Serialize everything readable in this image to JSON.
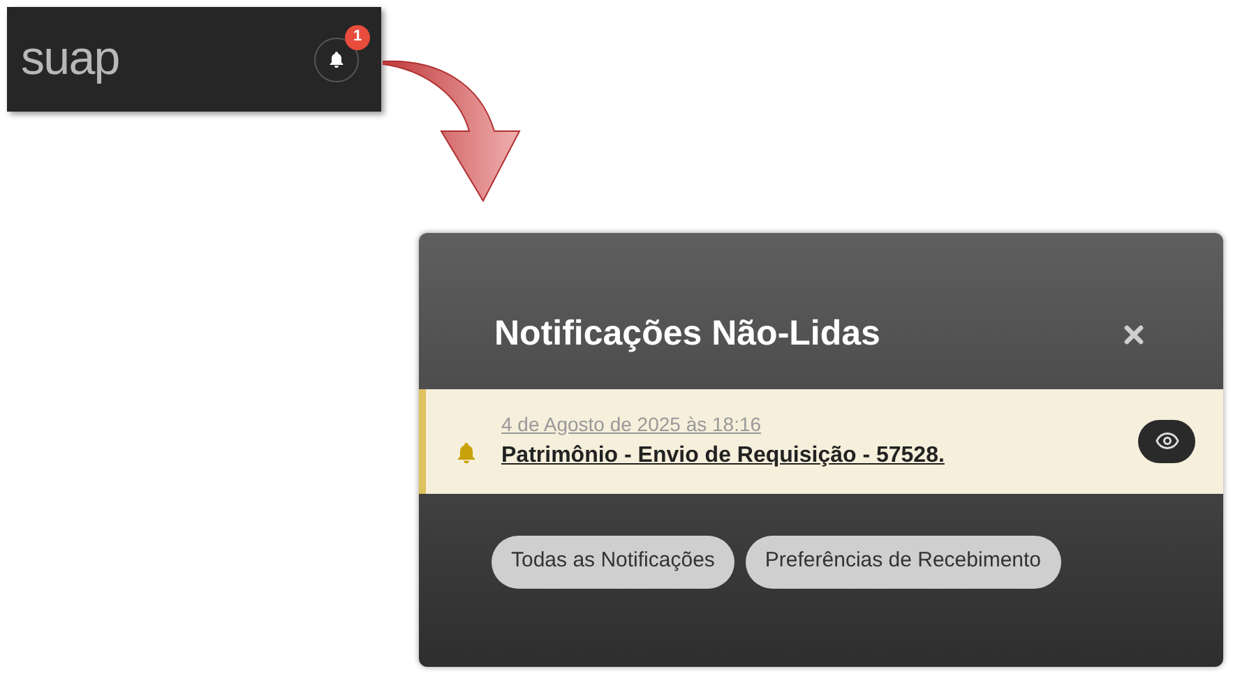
{
  "header": {
    "logo": "suap",
    "notification_count": "1"
  },
  "panel": {
    "title": "Notificações Não-Lidas",
    "notifications": [
      {
        "date": "4 de Agosto de 2025 às 18:16",
        "title": "Patrimônio - Envio de Requisição - 57528.",
        "unread": true
      }
    ],
    "buttons": [
      "Todas as Notificações",
      "Preferências de Recebimento"
    ]
  }
}
